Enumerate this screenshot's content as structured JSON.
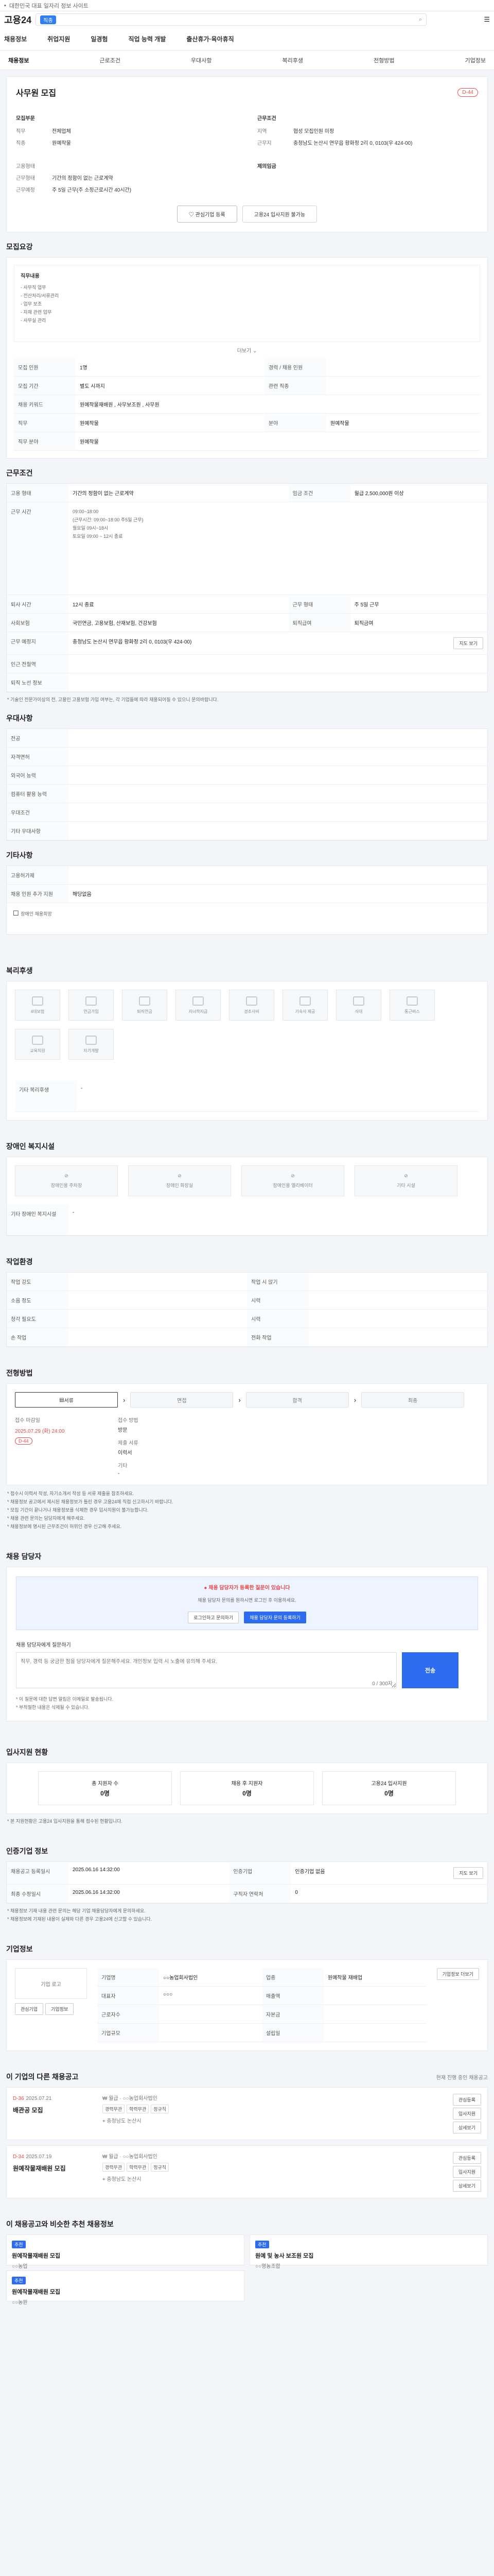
{
  "topbar": {
    "text": "대한민국 대표 일자리 정보 사이트"
  },
  "search": {
    "tag": "직종",
    "placeholder": "",
    "logo": "고용24"
  },
  "mainnav": [
    "채용정보",
    "취업지원",
    "일경험",
    "직업 능력 개발",
    "출산휴가·육아휴직"
  ],
  "subnav": {
    "items": [
      "채용정보",
      "근로조건",
      "우대사항",
      "복리후생",
      "전형방법",
      "기업정보"
    ],
    "active": 0
  },
  "header": {
    "title": "사무원 모집",
    "dday": "D-44",
    "left_heading": "모집부문",
    "right_heading": "근무조건",
    "rows_left": [
      [
        "직무",
        "전체업체"
      ],
      [
        "직종",
        "원예작물"
      ]
    ],
    "rows_right": [
      [
        "지역",
        "협성 모집인원 미정"
      ],
      [
        "근무지",
        "충청남도 논산시 연무읍 황화정 2리 0, 0103(우 424-00)"
      ]
    ],
    "rows_left2": [
      [
        "고용형태",
        ""
      ],
      [
        "근무형태",
        "기간의 정함이 없는 근로계약"
      ],
      [
        "근무예정",
        "주 5일 근무(주 소정근로시간 40시간)"
      ]
    ],
    "wage_label": "제의임금",
    "btn_interest": "관심기업 등록",
    "btn_apply": "고용24 입사지원 불가능"
  },
  "sec_recruit": {
    "title": "모집요강",
    "jobdesc_title": "직무내용",
    "jobdesc": [
      "- 사무직 업무",
      "- 전산처리/서류관리",
      "- 업무 보조",
      "- 자재 관련 업무",
      "- 사무실 관리"
    ],
    "more": "더보기",
    "rows": [
      [
        "모집 인원",
        "1명",
        "경력 / 채용 인원",
        ""
      ],
      [
        "모집 기간",
        "별도 시까지",
        "관련 직종",
        ""
      ],
      [
        "채용 키워드",
        "원예작물재배원 , 사무보조원 , 사무원",
        "",
        ""
      ],
      [
        "직무",
        "원예작물",
        "분야",
        "원예작물"
      ],
      [
        "직무 분야",
        "원예작물",
        "",
        ""
      ]
    ]
  },
  "sec_cond": {
    "title": "근무조건",
    "rows": [
      [
        "고용 형태",
        "기간의 정함이 없는 근로계약"
      ],
      [
        "임금 조건",
        "월급 2,500,000원 이상"
      ],
      [
        "근무 시간",
        "주 소정근로시간 40시간"
      ],
      [
        "퇴사 시간",
        "12시 종료"
      ],
      [
        "사회보험",
        "국민연금, 고용보험, 산재보험, 건강보험"
      ],
      [
        "근무 예정지",
        "충청남도 논산시 연무읍 황화정 2리 0, 0103(우 424-00)"
      ],
      [
        "인근 전철역",
        ""
      ],
      [
        "퇴직 노선 정보",
        ""
      ]
    ],
    "worktime": [
      "09:00~18:00",
      "(근무시간: 09:00~18:00 주5일 근무)",
      "월요일 09시~18시",
      "토요일 09:00 ~ 12시 종료"
    ],
    "mapbtn": "지도 보기",
    "weekday": "주 5일 근무",
    "retire": "퇴직금여",
    "note": "* 기술인 전문가이상의 전, 고용인 고용보험 가입 여부는, 각 기업들에 따라 재용되어질 수 있으니 문의바랍니다."
  },
  "sec_pref": {
    "title": "우대사항",
    "rows": [
      [
        "전공",
        ""
      ],
      [
        "자격면허",
        ""
      ],
      [
        "외국어 능력",
        ""
      ],
      [
        "컴퓨터 활용 능력",
        ""
      ],
      [
        "우대조건",
        ""
      ],
      [
        "기타 우대사항",
        ""
      ]
    ]
  },
  "sec_etc": {
    "title": "기타사항",
    "rows": [
      [
        "고용허가제",
        ""
      ],
      [
        "채용 인원 추가 지원",
        "해당없음"
      ]
    ],
    "note": "장애인 채용희망"
  },
  "sec_welfare": {
    "title": "복리후생",
    "icons": [
      "4대보험",
      "연금가입",
      "퇴직연금",
      "자녀학자금",
      "경조사비",
      "기숙사 제공",
      "식대",
      "통근버스",
      "교육지원",
      "자기개발"
    ],
    "extra_title": "기타 복리후생",
    "extra": "-"
  },
  "sec_disabled": {
    "title": "장애인 복지시설",
    "icons": [
      "장애인용 주차장",
      "장애인 화장실",
      "장애인용 엘리베이터",
      "기타 시설"
    ],
    "extra_title": "기타 장애인 복지시설",
    "extra": "-"
  },
  "sec_env": {
    "title": "작업환경",
    "rows": [
      [
        "작업 강도",
        "",
        "작업 시 앉기",
        ""
      ],
      [
        "소음 정도",
        "",
        "시력",
        ""
      ],
      [
        "청각 필요도",
        "",
        "시력",
        ""
      ],
      [
        "손 작업",
        "",
        "전화 작업",
        ""
      ]
    ]
  },
  "sec_process": {
    "title": "전형방법",
    "steps": [
      "서류",
      "면접",
      "합격",
      "최종"
    ],
    "apply_label": "접수 마감일",
    "apply_date": "2025.07.29 (화) 24:00",
    "dday": "D-44",
    "method_label": "접수 방법",
    "method": "방문",
    "docs_label": "제출 서류",
    "docs": "이력서",
    "extra_label": "기타",
    "extra": "-",
    "notes": [
      "* 접수시 이력서 작성, 자기소개서 작성 등 서류 제출을 참조하세요.",
      "* 채용정보 공고에서 제시된 채용정보가 틀린 경우 고용24에 직접 신고하시기 바랍니다.",
      "* 모집 기간이 끝나거나 채용정보를 삭제한 경우 입사지원이 불가능합니다.",
      "* 채용 관련 문의는 담당자에게 해주세요.",
      "* 채용정보에 명시된 근무조건이 허위인 경우 신고해 주세요."
    ]
  },
  "sec_inquiry": {
    "title": "채용 담당자",
    "warn_title": "채용 담당자가 등록한 질문이 있습니다",
    "warn1": "채용 담당자 문의를 원하시면 로그인 후 이용하세요.",
    "warn2": "",
    "btn_login": "로그인하고 문의하기",
    "btn_inquiry": "채용 담당자 문의 등록하기",
    "ta_label": "채용 담당자에게 질문하기",
    "ta_placeholder": "직무, 경력 등 궁금한 점을 담당자에게 질문해주세요. 개인정보 입력 시 노출에 유의해 주세요.",
    "ta_count": "0 / 300자",
    "send": "전송",
    "notes": [
      "* 이 질문에 대한 답변 알림은 이메일로 발송됩니다.",
      "* 부적절한 내용은 삭제될 수 있습니다."
    ]
  },
  "sec_status": {
    "title": "입사지원 현황",
    "boxes": [
      [
        "총 지원자 수",
        "0명"
      ],
      [
        "채용 후 지원자",
        "0명"
      ],
      [
        "고용24 입사지원",
        "0명"
      ]
    ],
    "note": "* 본 지원현황은 고용24 입사지원을 통해 접수된 현황입니다."
  },
  "sec_info": {
    "title": "인증기업 정보",
    "rows": [
      [
        "채용공고 등록일시",
        "2025.06.16 14:32:00",
        "인증기업",
        "인증기업 없음"
      ],
      [
        "최종 수정일시",
        "2025.06.16 14:32:00",
        "구직자 연락처",
        "0"
      ]
    ],
    "btn": "지도 보기",
    "notes": [
      "* 채용정보 기재 내용 관련 문의는 해당 기업 채용담당자에게 문의하세요.",
      "* 채용정보에 기재된 내용이 실제와 다른 경우 고용24에 신고할 수 있습니다."
    ]
  },
  "sec_company": {
    "title": "기업정보",
    "logo_label": "기업 로고",
    "btn_a": "관심기업",
    "btn_b": "기업정보",
    "rows": [
      [
        "기업명",
        "○○농업회사법인",
        "업종",
        "원예작물 재배업"
      ],
      [
        "대표자",
        "○○○",
        "매출액",
        ""
      ],
      [
        "근로자수",
        "",
        "자본금",
        ""
      ],
      [
        "기업규모",
        "",
        "설립일",
        ""
      ]
    ],
    "btn_more": "기업정보 더보기"
  },
  "sec_other": {
    "title": "이 기업의 다른 채용공고",
    "sub": "현재 진행 중인 채용공고",
    "cards": [
      {
        "dday": "D-36",
        "date": "2025.07.21",
        "title": "배관공 모집",
        "wage": "월급",
        "company": "○○농업회사법인",
        "tags": [
          "경력무관",
          "학력무관",
          "정규직"
        ],
        "loc": "충청남도 논산시"
      },
      {
        "dday": "D-34",
        "date": "2025.07.19",
        "title": "원예작물재배원 모집",
        "wage": "월급",
        "company": "○○농업회사법인",
        "tags": [
          "경력무관",
          "학력무관",
          "정규직"
        ],
        "loc": "충청남도 논산시"
      }
    ],
    "btns": [
      "관심등록",
      "입사지원",
      "상세보기"
    ]
  },
  "sec_rec": {
    "title": "이 채용공고와 비슷한 추천 채용정보",
    "cards": [
      [
        "추천",
        "원예작물재배원 모집",
        "○○농업"
      ],
      [
        "추천",
        "원예 및 농사 보조원 모집",
        "○○영농조합"
      ],
      [
        "추천",
        "원예작물재배원 모집",
        "○○농원"
      ]
    ]
  }
}
